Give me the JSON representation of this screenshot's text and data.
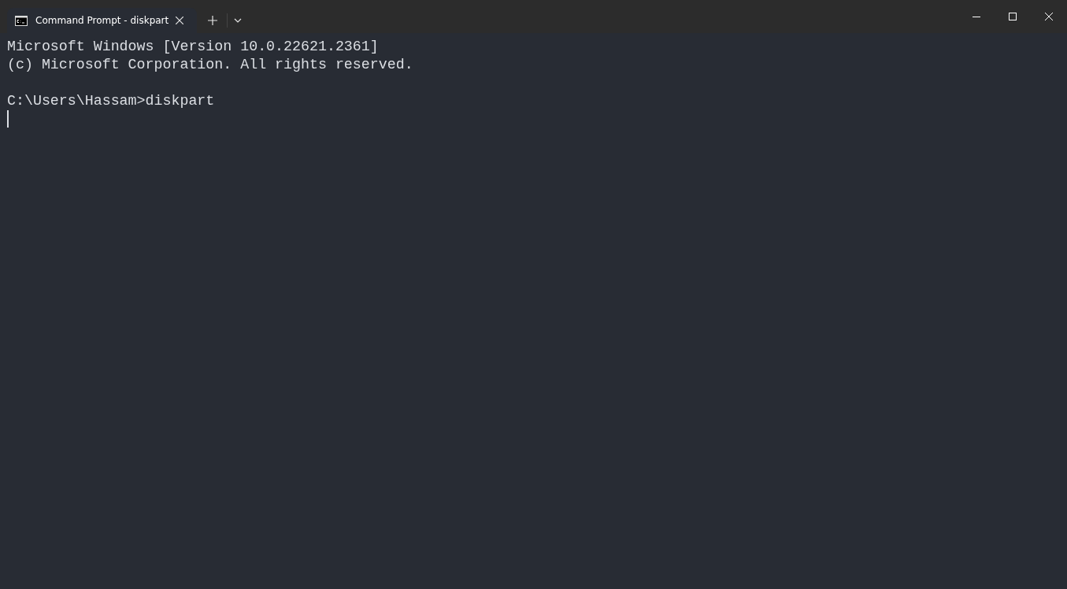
{
  "tabs": [
    {
      "label": "Command Prompt - diskpart",
      "selected": true
    }
  ],
  "console": {
    "lines": [
      {
        "kind": "text",
        "text": "Microsoft Windows [Version 10.0.22621.2361]"
      },
      {
        "kind": "text",
        "text": "(c) Microsoft Corporation. All rights reserved."
      },
      {
        "kind": "blank"
      },
      {
        "kind": "text",
        "text": "C:\\Users\\Hassam>diskpart"
      },
      {
        "kind": "cursor"
      }
    ]
  }
}
